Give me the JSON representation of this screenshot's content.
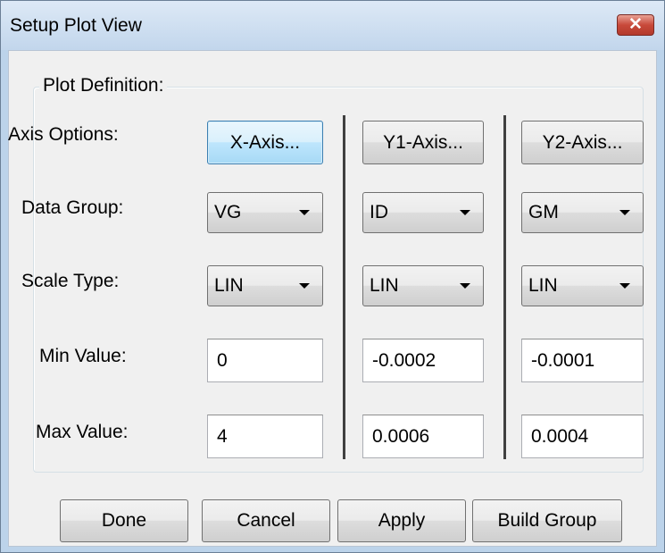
{
  "window": {
    "title": "Setup Plot View",
    "close_glyph": "✕"
  },
  "group": {
    "label": "Plot Definition:"
  },
  "rows": {
    "axis_options": "Axis Options:",
    "data_group": "Data Group:",
    "scale_type": "Scale Type:",
    "min_value": "Min Value:",
    "max_value": "Max Value:"
  },
  "axes": {
    "x": {
      "button": "X-Axis...",
      "data_group": "VG",
      "scale_type": "LIN",
      "min": "0",
      "max": "4"
    },
    "y1": {
      "button": "Y1-Axis...",
      "data_group": "ID",
      "scale_type": "LIN",
      "min": "-0.0002",
      "max": "0.0006"
    },
    "y2": {
      "button": "Y2-Axis...",
      "data_group": "GM",
      "scale_type": "LIN",
      "min": "-0.0001",
      "max": "0.0004"
    }
  },
  "footer": {
    "done": "Done",
    "cancel": "Cancel",
    "apply": "Apply",
    "build_group": "Build Group"
  },
  "colors": {
    "titlebar": "#c9dcef",
    "close_button": "#c8493a",
    "client": "#f0f0f0",
    "focused_button": "#bee6fd"
  }
}
